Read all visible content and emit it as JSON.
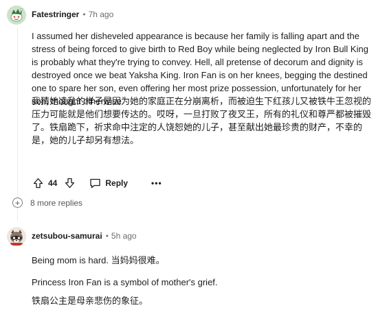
{
  "comments": [
    {
      "author": "Fatestringer",
      "separator": "•",
      "time": "7h ago",
      "avatar_icon": "snoo-avatar-icon",
      "paragraphs": [
        "I assumed her disheveled appearance is because her family is falling apart and the stress of being forced to give birth to Red Boy while being neglected by Iron Bull King is probably what they're trying to convey. Hell, all pretense of decorum and dignity is destroyed once we beat Yaksha King. Iron Fan is on her knees, begging the destined one to spare her son, even offering her most prize possession, unfortunately for her son, thought otherwise.",
        "我猜她凌乱的样子是因为她的家庭正在分崩离析，而被迫生下红孩儿又被铁牛王忽视的压力可能就是他们想要传达的。哎呀，一旦打败了夜叉王，所有的礼仪和尊严都被摧毁了。铁扇跪下，祈求命中注定的人饶恕她的儿子，甚至献出她最珍贵的财产，不幸的是，她的儿子却另有想法。"
      ],
      "score": "44",
      "reply_label": "Reply",
      "more_label": "•••",
      "more_replies": "8 more replies"
    },
    {
      "author": "zetsubou-samurai",
      "separator": "•",
      "time": "5h ago",
      "avatar_icon": "raccoon-avatar-icon",
      "paragraphs": [
        "Being mom is hard. 当妈妈很难。",
        "Princess Iron Fan is a symbol of mother's grief.",
        "铁扇公主是母亲悲伤的象征。"
      ]
    }
  ],
  "colors": {
    "text": "#1c1c1c",
    "meta": "#6a6a6a",
    "thread_line": "#e5ebee"
  }
}
